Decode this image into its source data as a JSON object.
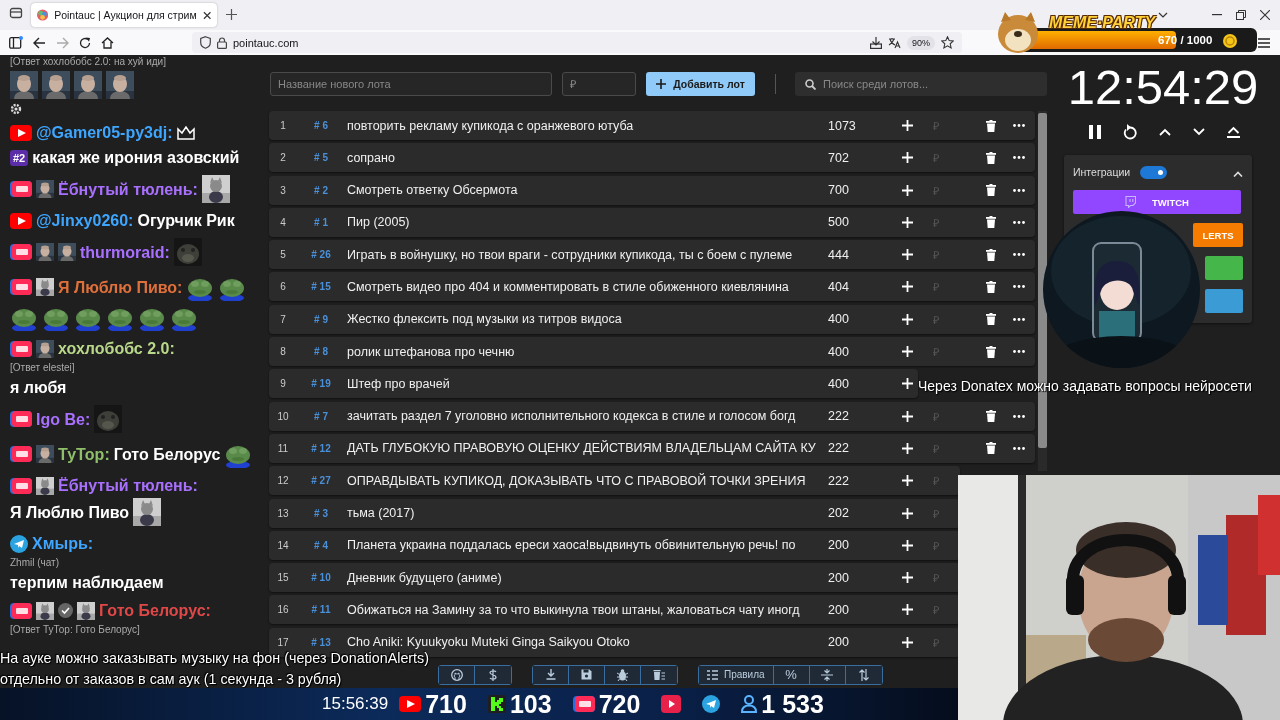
{
  "browser": {
    "tab_title": "Pointauc | Аукцион для стрим",
    "url": "pointauc.com",
    "zoom": "90%"
  },
  "meme_party": {
    "title": "MEME·PARTY",
    "progress": "670 / 1000",
    "level": 0.67
  },
  "chat": {
    "messages": [
      {
        "parts": [
          {
            "kind": "reply",
            "text": "[Ответ хохлобобс 2.0: на хуй иди]"
          },
          {
            "kind": "picture"
          },
          {
            "kind": "picture"
          },
          {
            "kind": "picture"
          },
          {
            "kind": "picture"
          },
          {
            "kind": "break"
          },
          {
            "kind": "gear"
          }
        ]
      },
      {
        "kind": "youtube",
        "author": "@Gamer05-py3dj:",
        "color": "#3ea6ff",
        "parts": [
          {
            "kind": "crown"
          },
          {
            "kind": "break"
          },
          {
            "kind": "tag",
            "text": "#2"
          },
          {
            "kind": "text",
            "text": "какая же ирония азовский"
          }
        ]
      },
      {
        "kind": "live",
        "badges": [
          {
            "kind": "picture"
          }
        ],
        "author": "Ёбнутый тюлень:",
        "color": "#a970ff",
        "parts": [
          {
            "kind": "picture"
          }
        ]
      },
      {
        "kind": "youtube",
        "author": "@Jinxy0260:",
        "color": "#3ea6ff",
        "parts": [
          {
            "kind": "text",
            "text": "Огурчик Рик"
          }
        ]
      },
      {
        "kind": "live",
        "badges": [
          {
            "kind": "picture"
          },
          {
            "kind": "picture"
          }
        ],
        "author": "thurmoraid:",
        "color": "#a970ff",
        "parts": [
          {
            "kind": "picture"
          }
        ]
      },
      {
        "kind": "live",
        "badges": [
          {
            "kind": "picture"
          }
        ],
        "author": "Я Люблю Пиво:",
        "color": "#e0703a",
        "parts": [
          {
            "kind": "picture"
          },
          {
            "kind": "picture"
          },
          {
            "kind": "picture"
          },
          {
            "kind": "picture"
          },
          {
            "kind": "picture"
          },
          {
            "kind": "picture"
          },
          {
            "kind": "picture"
          },
          {
            "kind": "picture"
          }
        ]
      },
      {
        "kind": "live",
        "badges": [
          {
            "kind": "picture"
          }
        ],
        "author": "хохлобобс 2.0:",
        "color": "#b9d88a",
        "parts": [
          {
            "kind": "reply",
            "text": "[Ответ elestei]"
          },
          {
            "kind": "text",
            "text": "я любя"
          }
        ]
      },
      {
        "kind": "live",
        "author": "Igo Be:",
        "color": "#a970ff",
        "parts": [
          {
            "kind": "picture"
          }
        ]
      },
      {
        "kind": "live",
        "badges": [
          {
            "kind": "picture"
          }
        ],
        "author": "ТуТор:",
        "color": "#8fbf6a",
        "parts": [
          {
            "kind": "text",
            "text": "Гото Белорус"
          },
          {
            "kind": "picture"
          }
        ]
      },
      {
        "kind": "live",
        "badges": [
          {
            "kind": "picture"
          }
        ],
        "author": "Ёбнутый тюлень:",
        "color": "#a970ff",
        "parts": [
          {
            "kind": "text",
            "text": "Я Люблю Пиво"
          },
          {
            "kind": "picture"
          }
        ]
      },
      {
        "kind": "telegram",
        "author": "Хмырь:",
        "color": "#3ea6ff",
        "parts": [
          {
            "kind": "reply",
            "text": "Zhmil (чат)"
          },
          {
            "kind": "text",
            "text": "терпим наблюдаем"
          }
        ]
      },
      {
        "kind": "live",
        "badges": [
          {
            "kind": "picture"
          },
          {
            "kind": "verified"
          },
          {
            "kind": "picture"
          }
        ],
        "author": "Гото Белорус:",
        "color": "#e04848",
        "parts": [
          {
            "kind": "reply",
            "text": "[Ответ ТуТор: Гото Белорус]"
          }
        ]
      }
    ]
  },
  "lot_form": {
    "name_placeholder": "Название нового лота",
    "price_placeholder": "₽",
    "add_button": "Добавить лот",
    "search_placeholder": "Поиск среди лотов..."
  },
  "lots": [
    {
      "index": "1",
      "id": "# 6",
      "name": "повторить рекламу купикода с оранжевого ютуба",
      "amount": "1073",
      "currency": "₽",
      "actions_shown": true
    },
    {
      "index": "2",
      "id": "# 5",
      "name": "сопрано",
      "amount": "702",
      "currency": "₽",
      "actions_shown": true
    },
    {
      "index": "3",
      "id": "# 2",
      "name": "Смотреть ответку Обсермота",
      "amount": "700",
      "currency": "₽",
      "actions_shown": true
    },
    {
      "index": "4",
      "id": "# 1",
      "name": "Пир (2005)",
      "amount": "500",
      "currency": "₽",
      "actions_shown": true
    },
    {
      "index": "5",
      "id": "# 26",
      "name": "Играть в войнушку, но твои враги - сотрудники купикода, ты с боем с пулеме",
      "amount": "444",
      "currency": "₽",
      "actions_shown": true
    },
    {
      "index": "6",
      "id": "# 15",
      "name": "Смотреть видео про 404 и комментировать в стиле обиженного киевлянина",
      "amount": "404",
      "currency": "₽",
      "actions_shown": true
    },
    {
      "index": "7",
      "id": "# 9",
      "name": "Жестко флексить под музыки из титров видоса",
      "amount": "400",
      "currency": "₽",
      "actions_shown": true
    },
    {
      "index": "8",
      "id": "# 8",
      "name": "ролик штефанова про чечню",
      "amount": "400",
      "currency": "₽",
      "actions_shown": true
    },
    {
      "index": "9",
      "id": "# 19",
      "name": "Штеф про врачей",
      "amount": "400"
    },
    {
      "index": "10",
      "id": "# 7",
      "name": "зачитать раздел 7 уголовно исполнительного кодекса в стиле и голосом богд",
      "amount": "222",
      "currency": "₽",
      "actions_shown": true
    },
    {
      "index": "11",
      "id": "# 12",
      "name": "ДАТЬ ГЛУБОКУЮ ПРАВОВУЮ ОЦЕНКУ ДЕЙСТВИЯМ ВЛАДЕЛЬЦАМ САЙТА КУ",
      "amount": "222",
      "currency": "₽",
      "actions_shown": true
    },
    {
      "index": "12",
      "id": "# 27",
      "name": "ОПРАВДЫВАТЬ КУПИКОД, ДОКАЗЫВАТЬ ЧТО С ПРАВОВОЙ ТОЧКИ ЗРЕНИЯ",
      "amount": "222",
      "currency": "₽",
      "actions_shown": false
    },
    {
      "index": "13",
      "id": "# 3",
      "name": "тьма (2017)",
      "amount": "202",
      "currency": "₽",
      "actions_shown": false
    },
    {
      "index": "14",
      "id": "# 4",
      "name": "Планета украина поддалась ереси хаоса!выдвинуть обвинительную речь! по",
      "amount": "200",
      "currency": "₽",
      "actions_shown": false
    },
    {
      "index": "15",
      "id": "# 10",
      "name": "Дневник будущего (аниме)",
      "amount": "200",
      "currency": "₽",
      "actions_shown": false
    },
    {
      "index": "16",
      "id": "# 11",
      "name": "Обижаться на Замину за то что выкинула твои штаны, жаловаться чату иногд",
      "amount": "200",
      "currency": "₽",
      "actions_shown": false
    },
    {
      "index": "17",
      "id": "# 13",
      "name": "Cho Aniki: Kyuukyoku Muteki Ginga Saikyou Otoko",
      "amount": "200",
      "currency": "₽",
      "actions_shown": false
    }
  ],
  "toolbar": {
    "rules": "Правила",
    "percent": "%"
  },
  "timer": {
    "time": "12:54:29"
  },
  "integrations": {
    "label": "Интеграции",
    "on": true,
    "expanded": true,
    "buttons": [
      {
        "kind": "twitch",
        "label": "TWITCH",
        "color": "#9146ff"
      },
      {
        "kind": "plain",
        "label": "LERTS",
        "color": "#f57c00"
      },
      {
        "kind": "plain",
        "color": "#45b649"
      },
      {
        "kind": "plain",
        "color": "#3a9bd5"
      }
    ]
  },
  "overlay": {
    "donatex_note": "Через Donatex можно задавать вопросы нейросети",
    "captions": [
      "На ауке можно заказывать музыку на фон (через DonationAlerts)",
      "отдельно от заказов в сам аук (1 секунда - 3 рубля)"
    ],
    "stats": {
      "time": "15:56:39",
      "items": [
        {
          "kind": "youtube",
          "value": "710"
        },
        {
          "kind": "kick",
          "value": "103"
        },
        {
          "kind": "live",
          "value": "720"
        },
        {
          "kind": "rutube"
        },
        {
          "kind": "telegram"
        },
        {
          "kind": "viewers",
          "value": "1 533"
        }
      ]
    }
  },
  "webcam": {
    "kind": "picture"
  },
  "avatar": {
    "kind": "picture"
  }
}
